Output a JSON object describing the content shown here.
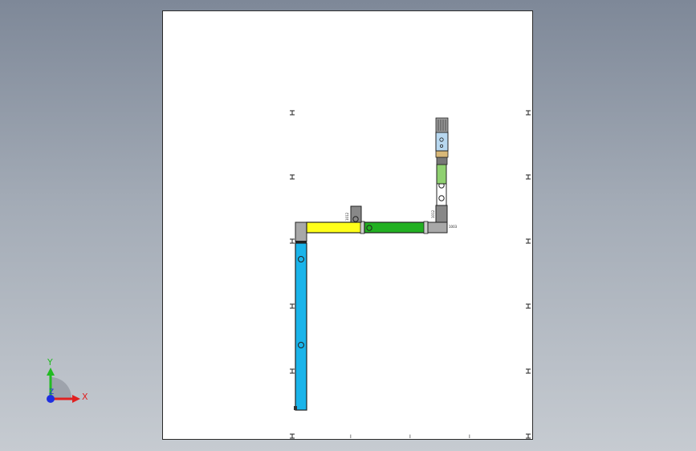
{
  "triad": {
    "x_label": "X",
    "y_label": "Y",
    "z_label": "Z",
    "colors": {
      "x": "#e02020",
      "y": "#22bb22",
      "z": "#1e2ee0"
    }
  },
  "drawing": {
    "tick_labels_bottom": [
      "I",
      "I",
      "I"
    ],
    "part_labels": [
      "1012",
      "1012",
      "1003"
    ],
    "colors": {
      "blue_bar": "#1ab4ea",
      "yellow_bar": "#ffff1a",
      "green_bar": "#22b022",
      "light_green": "#8fd070",
      "light_blue": "#b8d8f0",
      "gray_block": "#a8a8a8",
      "tan": "#d8b878"
    }
  }
}
